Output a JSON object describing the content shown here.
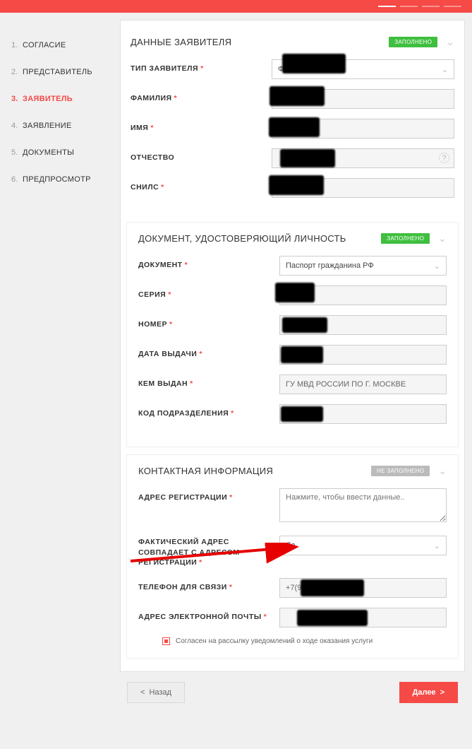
{
  "sidebar": {
    "items": [
      {
        "num": "1.",
        "label": "СОГЛАСИЕ"
      },
      {
        "num": "2.",
        "label": "ПРЕДСТАВИТЕЛЬ"
      },
      {
        "num": "3.",
        "label": "ЗАЯВИТЕЛЬ"
      },
      {
        "num": "4.",
        "label": "ЗАЯВЛЕНИЕ"
      },
      {
        "num": "5.",
        "label": "ДОКУМЕНТЫ"
      },
      {
        "num": "6.",
        "label": "ПРЕДПРОСМОТР"
      }
    ],
    "active_index": 2
  },
  "sections": {
    "applicant": {
      "title": "ДАННЫЕ ЗАЯВИТЕЛЯ",
      "badge": "ЗАПОЛНЕНО",
      "fields": {
        "type_label": "ТИП ЗАЯВИТЕЛЯ",
        "type_value": "Физическ",
        "lastname_label": "ФАМИЛИЯ",
        "firstname_label": "ИМЯ",
        "patronymic_label": "ОТЧЕСТВО",
        "snils_label": "СНИЛС"
      }
    },
    "identity": {
      "title": "ДОКУМЕНТ, УДОСТОВЕРЯЮЩИЙ ЛИЧНОСТЬ",
      "badge": "ЗАПОЛНЕНО",
      "fields": {
        "doc_label": "ДОКУМЕНТ",
        "doc_value": "Паспорт гражданина РФ",
        "series_label": "СЕРИЯ",
        "number_label": "НОМЕР",
        "issue_date_label": "ДАТА ВЫДАЧИ",
        "issued_by_label": "КЕМ ВЫДАН",
        "issued_by_value": "ГУ МВД РОССИИ ПО Г. МОСКВЕ",
        "dept_code_label": "КОД ПОДРАЗДЕЛЕНИЯ"
      }
    },
    "contact": {
      "title": "КОНТАКТНАЯ ИНФОРМАЦИЯ",
      "badge": "НЕ ЗАПОЛНЕНО",
      "fields": {
        "reg_addr_label": "АДРЕС РЕГИСТРАЦИИ",
        "reg_addr_placeholder": "Нажмите, чтобы ввести данные..",
        "same_addr_label": "ФАКТИЧЕСКИЙ АДРЕС СОВПАДАЕТ С АДРЕСОМ РЕГИСТРАЦИИ",
        "same_addr_value": "Да",
        "phone_label": "ТЕЛЕФОН ДЛЯ СВЯЗИ",
        "phone_prefix": "+7(9",
        "email_label": "АДРЕС ЭЛЕКТРОННОЙ ПОЧТЫ",
        "consent_text": "Согласен на рассылку уведомлений о ходе оказания услуги"
      }
    }
  },
  "footer": {
    "back": "Назад",
    "next": "Далее"
  }
}
